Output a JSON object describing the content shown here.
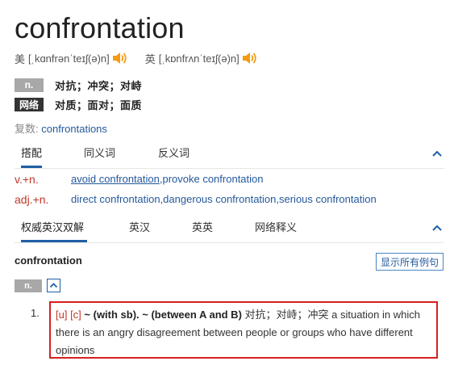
{
  "headword": "confrontation",
  "pronunciation": {
    "us_label": "美",
    "us_ipa": "[ˌkɑnfrənˈteɪʃ(ə)n]",
    "uk_label": "英",
    "uk_ipa": "[ˌkɒnfrʌnˈteɪʃ(ə)n]",
    "speaker_color": "#f39c12"
  },
  "basic_defs": [
    {
      "tag": "n.",
      "text": "对抗；冲突；对峙"
    },
    {
      "tag": "网络",
      "text": "对质；面对；面质"
    }
  ],
  "plural": {
    "label": "复数:",
    "value": "confrontations"
  },
  "collocation_tabs": [
    "搭配",
    "同义词",
    "反义词"
  ],
  "collocations": [
    {
      "label": "v.+n.",
      "underlined": "avoid confrontation",
      "rest": ",provoke confrontation"
    },
    {
      "label": "adj.+n.",
      "underlined": "",
      "rest": "direct confrontation,dangerous confrontation,serious confrontation"
    }
  ],
  "dict_tabs": [
    "权威英汉双解",
    "英汉",
    "英英",
    "网络释义"
  ],
  "definition": {
    "word": "confrontation",
    "show_examples": "显示所有例句",
    "pos": "n.",
    "sense_number": "1.",
    "grammar": "[u] [c]",
    "pattern": " ~ (with sb). ~ (between A and B)",
    "text": " 对抗；对峙；冲突 a situation in which there is an angry disagreement between people or groups who have different opinions"
  },
  "colors": {
    "link": "#24599b",
    "accent": "#1f5fa6",
    "highlight_border": "#d92020",
    "label_red": "#c0392b"
  }
}
